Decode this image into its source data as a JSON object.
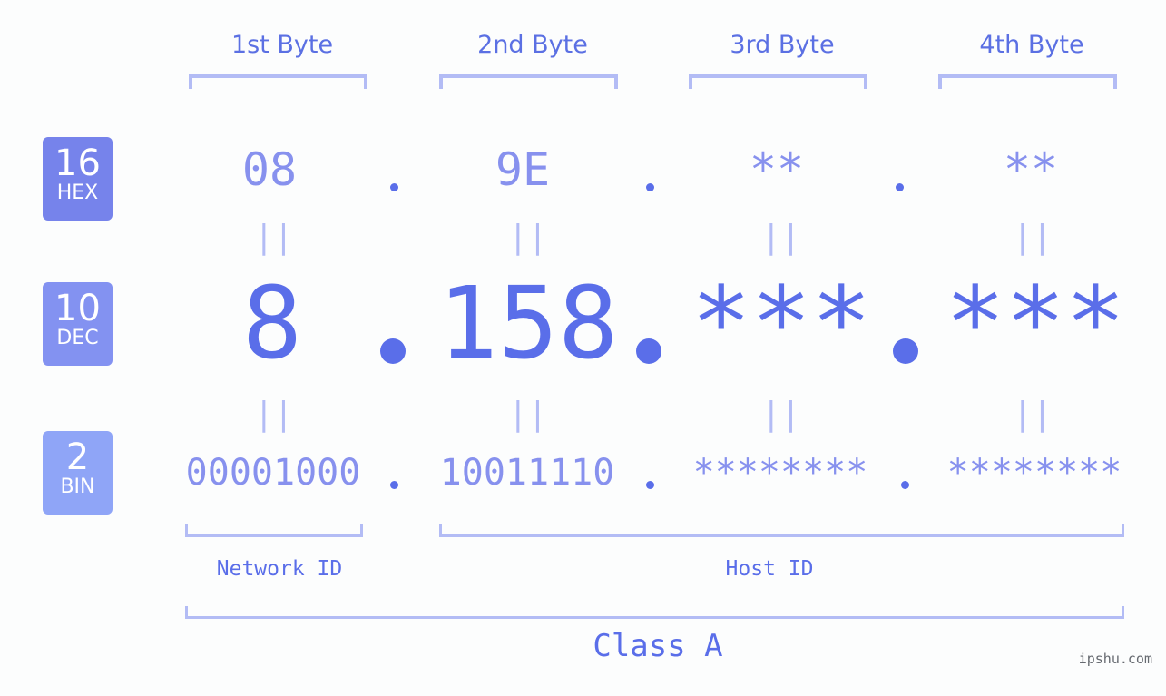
{
  "badges": [
    {
      "number": "16",
      "label": "HEX",
      "color": "#7683eb"
    },
    {
      "number": "10",
      "label": "DEC",
      "color": "#8392f1"
    },
    {
      "number": "2",
      "label": "BIN",
      "color": "#8fa5f7"
    }
  ],
  "bytes": [
    {
      "label": "1st Byte",
      "hex": "08",
      "dec": "8",
      "bin": "00001000"
    },
    {
      "label": "2nd Byte",
      "hex": "9E",
      "dec": "158",
      "bin": "10011110"
    },
    {
      "label": "3rd Byte",
      "hex": "**",
      "dec": "***",
      "bin": "********"
    },
    {
      "label": "4th Byte",
      "hex": "**",
      "dec": "***",
      "bin": "********"
    }
  ],
  "equals_symbol": "||",
  "segments": {
    "network_id": "Network ID",
    "host_id": "Host ID"
  },
  "ip_class": "Class A",
  "watermark": "ipshu.com",
  "colors": {
    "accent": "#5a6ee9",
    "light_accent": "#8791ee",
    "bracket": "#b3bcf5"
  }
}
